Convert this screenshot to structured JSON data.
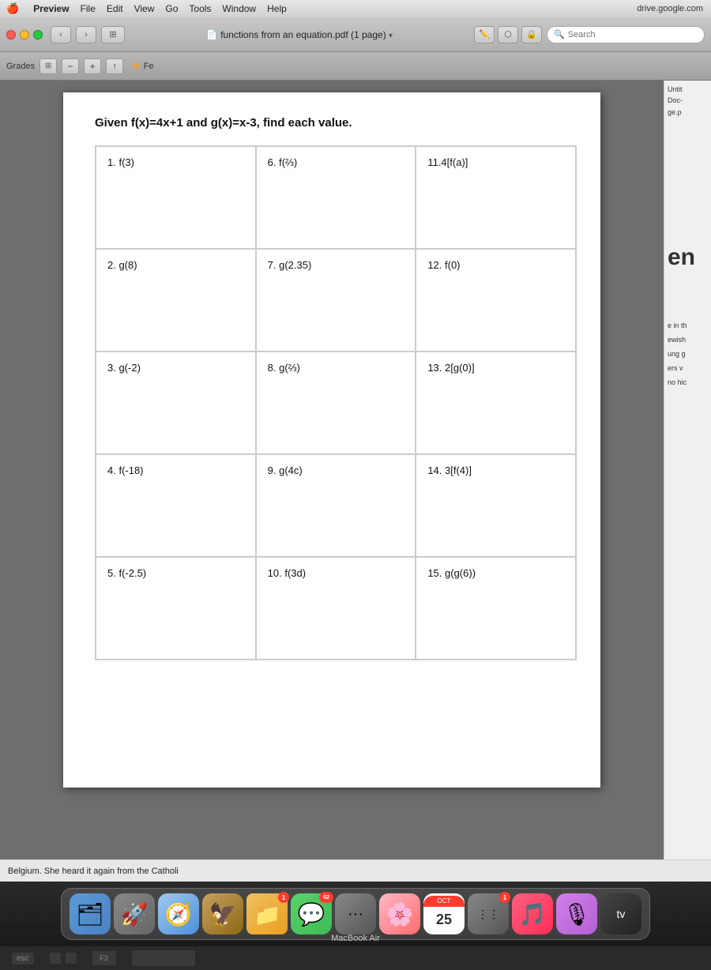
{
  "menubar": {
    "apple": "🍎",
    "items": [
      "Preview",
      "File",
      "Edit",
      "View",
      "Go",
      "Tools",
      "Window",
      "Help"
    ],
    "right_text": "drive.google.com"
  },
  "toolbar": {
    "title": "functions from an equation.pdf (1 page)",
    "search_placeholder": "Search",
    "search_label": "Search"
  },
  "toolbar2": {
    "sidebar_icon": "⊞",
    "zoom_minus": "−",
    "zoom_plus": "+",
    "share_icon": "↑"
  },
  "sidebar": {
    "favorite_label": "Fe",
    "favorite_star": "★"
  },
  "pdf": {
    "title": "Given f(x)=4x+1 and g(x)=x-3, find each value.",
    "problems": [
      {
        "id": "1",
        "label": "1. f(3)"
      },
      {
        "id": "6",
        "label": "6. f(⅔)"
      },
      {
        "id": "11",
        "label": "11.4[f(a)]"
      },
      {
        "id": "2",
        "label": "2. g(8)"
      },
      {
        "id": "7",
        "label": "7. g(2.35)"
      },
      {
        "id": "12",
        "label": "12. f(0)"
      },
      {
        "id": "3",
        "label": "3. g(-2)"
      },
      {
        "id": "8",
        "label": "8. g(⅔)"
      },
      {
        "id": "13",
        "label": "13. 2[g(0)]"
      },
      {
        "id": "4",
        "label": "4. f(-18)"
      },
      {
        "id": "9",
        "label": "9. g(4c)"
      },
      {
        "id": "14",
        "label": "14. 3[f(4)]"
      },
      {
        "id": "5",
        "label": "5. f(-2.5)"
      },
      {
        "id": "10",
        "label": "10. f(3d)"
      },
      {
        "id": "15",
        "label": "15. g(g(6))"
      }
    ]
  },
  "bottom_banner": {
    "text": "Belgium. She heard it again from the Catholi"
  },
  "right_panel": {
    "top_labels": [
      "Untit",
      "Doc-",
      "ge.p"
    ],
    "en_label": "en",
    "side_texts": [
      "e in th",
      "ewish",
      "ung g",
      "ers v",
      "no hic"
    ]
  },
  "dock": {
    "icons": [
      {
        "name": "finder",
        "emoji": "🗂",
        "color": "#5b9bd5",
        "badge": null
      },
      {
        "name": "launchpad",
        "emoji": "🚀",
        "color": "#6e6e6e",
        "badge": null
      },
      {
        "name": "safari",
        "emoji": "🧭",
        "color": "#4a90d9",
        "badge": null
      },
      {
        "name": "eagle",
        "emoji": "🦅",
        "color": "#8b6914",
        "badge": null
      },
      {
        "name": "messages-folder",
        "emoji": "📁",
        "color": "#e8a020",
        "badge": "1"
      },
      {
        "name": "messages",
        "emoji": "💬",
        "color": "#3cba54",
        "badge": "62"
      },
      {
        "name": "music-notes",
        "emoji": "🎵",
        "color": "#c8a030",
        "badge": null
      },
      {
        "name": "photos",
        "emoji": "🌸",
        "color": "#ff6b6b",
        "badge": null
      },
      {
        "name": "calendar",
        "emoji": "25",
        "color": "#ff3b30",
        "badge": null,
        "cal_month": "OCT",
        "cal_day": "25"
      },
      {
        "name": "dot-menu",
        "emoji": "⋯",
        "color": "#555",
        "badge": "1"
      },
      {
        "name": "music",
        "emoji": "🎵",
        "color": "#ff2d55",
        "badge": null
      },
      {
        "name": "podcasts",
        "emoji": "🎙",
        "color": "#b560d4",
        "badge": null
      },
      {
        "name": "apple-tv",
        "emoji": "📺",
        "color": "#222",
        "badge": null,
        "label": "tv"
      }
    ]
  },
  "keyboard": {
    "esc_label": "esc"
  },
  "macbook_label": "MacBook Air"
}
